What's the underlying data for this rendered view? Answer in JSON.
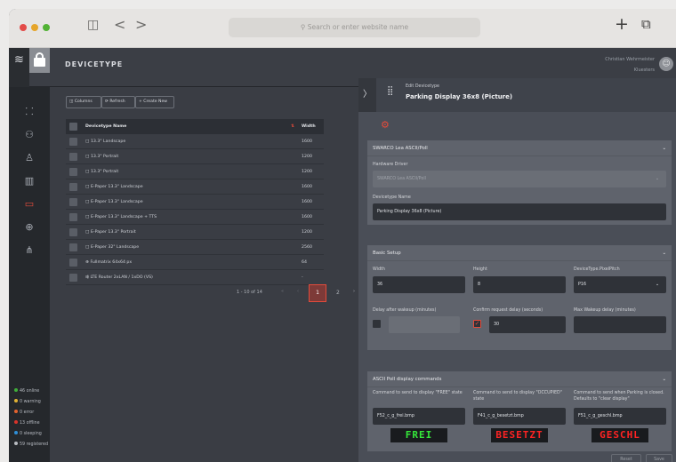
{
  "browser": {
    "search_placeholder": "Search or enter website name",
    "back": "<",
    "forward": ">",
    "plus": "+",
    "tabs": "⧉",
    "sidebar": "◫"
  },
  "app": {
    "title": "DEVICETYPE",
    "user_name": "Christian Wehrmeister",
    "user_org": "Kluesters"
  },
  "toolbar": {
    "columns": "Columns",
    "refresh": "Refresh",
    "create": "+ Create New"
  },
  "table": {
    "headers": [
      "Devicetype Name",
      "Width"
    ],
    "rows": [
      {
        "name": "13.3\" Landscape",
        "width": "1600",
        "icon": "□"
      },
      {
        "name": "13.3\" Portrait",
        "width": "1200",
        "icon": "□"
      },
      {
        "name": "13.3\" Portrait",
        "width": "1200",
        "icon": "□"
      },
      {
        "name": "E-Paper 13.3\" Landscape",
        "width": "1600",
        "icon": "□"
      },
      {
        "name": "E-Paper 13.3\" Landscape",
        "width": "1600",
        "icon": "□"
      },
      {
        "name": "E-Paper 13.3\" Landscape + TTS",
        "width": "1600",
        "icon": "□"
      },
      {
        "name": "E-Paper 13.3\" Portrait",
        "width": "1200",
        "icon": "□"
      },
      {
        "name": "E-Paper 32\" Landscape",
        "width": "2560",
        "icon": "□"
      },
      {
        "name": "Fullmatrix 64x64 px",
        "width": "64",
        "icon": "⊕"
      },
      {
        "name": "LTE Router 2xLAN / 1xDO (VS)",
        "width": "-",
        "icon": "⇶"
      }
    ]
  },
  "pagination": {
    "range": "1 - 10 of 14",
    "first": "«",
    "prev": "‹",
    "current": "1",
    "next_page": "2",
    "next": "›"
  },
  "panel": {
    "subtitle": "Edit Devicetype",
    "title": "Parking Display 36x8 (Picture)",
    "arrow": "〉",
    "section1": {
      "title": "SWARCO Lea ASCII/Poll",
      "driver_label": "Hardware Driver",
      "driver_value": "SWARCO Lea ASCII/Poll",
      "name_label": "Devicetype Name",
      "name_value": "Parking Display 36x8 (Picture)"
    },
    "section2": {
      "title": "Basic Setup",
      "width_label": "Width",
      "width_value": "36",
      "height_label": "Height",
      "height_value": "8",
      "pitch_label": "DeviceType.PixelPitch",
      "pitch_value": "P16",
      "delay_label": "Delay after wakeup (minutes)",
      "delay_value": "",
      "confirm_label": "Confirm request delay (seconds)",
      "confirm_value": "30",
      "maxwake_label": "Max Wakeup delay (minutes)",
      "maxwake_value": ""
    },
    "section3": {
      "title": "ASCII Poll display commands",
      "c1_label": "Command to send to display \"FREE\" state",
      "c1_value": "F52_c_g_frei.bmp",
      "c1_preview": "FREI",
      "c2_label": "Command to send to display \"OCCUPIED\" state",
      "c2_value": "F41_c_g_besetzt.bmp",
      "c2_preview": "BESETZT",
      "c3_label": "Command to send when Parking is closed. Defaults to \"clear display\"",
      "c3_value": "F51_c_g_geschl.bmp",
      "c3_preview": "GESCHL"
    },
    "reset": "Reset",
    "save": "Save"
  },
  "status": [
    {
      "text": "46 online",
      "color": "#3fae3a"
    },
    {
      "text": "0 warning",
      "color": "#e2b234"
    },
    {
      "text": "0 error",
      "color": "#e3632f"
    },
    {
      "text": "13 offline",
      "color": "#d9342b"
    },
    {
      "text": "0 sleeping",
      "color": "#2f8fd8"
    },
    {
      "text": "59 registered",
      "color": "#b9bcc2"
    }
  ],
  "colors": {
    "accent": "#e24b3b",
    "led_green": "#35e83a",
    "led_red": "#ff2323"
  }
}
